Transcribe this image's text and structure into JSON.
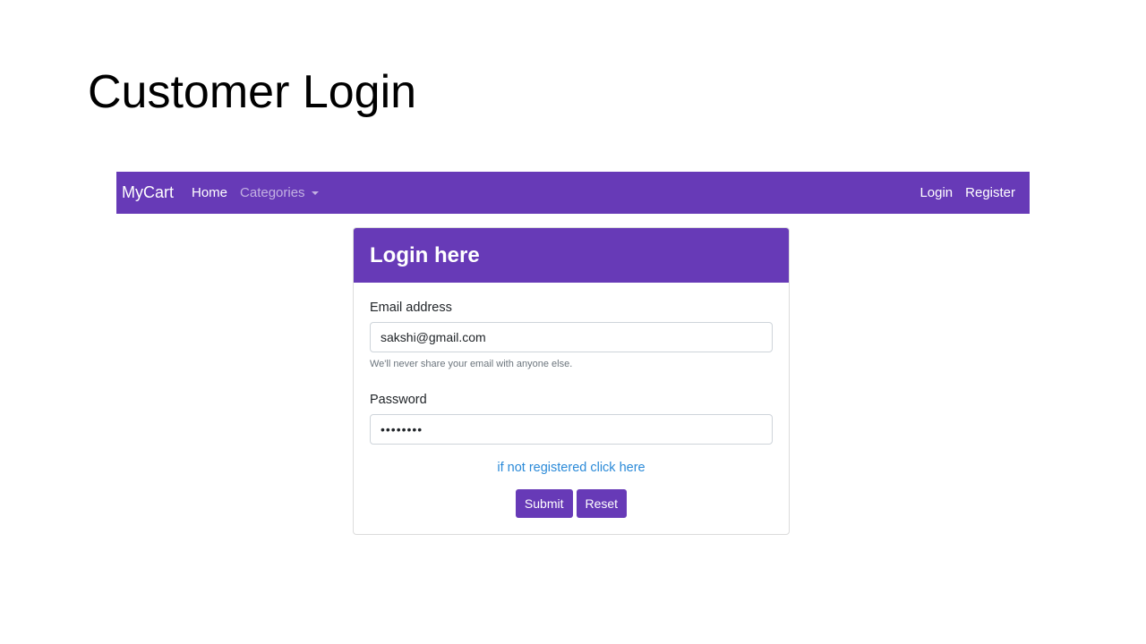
{
  "slide": {
    "title": "Customer Login"
  },
  "navbar": {
    "brand": "MyCart",
    "home": "Home",
    "categories": "Categories",
    "login": "Login",
    "register": "Register"
  },
  "login_card": {
    "header": "Login here",
    "email": {
      "label": "Email address",
      "value": "sakshi@gmail.com",
      "help": "We'll never share your email with anyone else."
    },
    "password": {
      "label": "Password",
      "value": "••••••••"
    },
    "register_link": "if not registered click here",
    "submit_label": "Submit",
    "reset_label": "Reset"
  },
  "colors": {
    "primary": "#673ab7",
    "link": "#2b8ad8"
  }
}
